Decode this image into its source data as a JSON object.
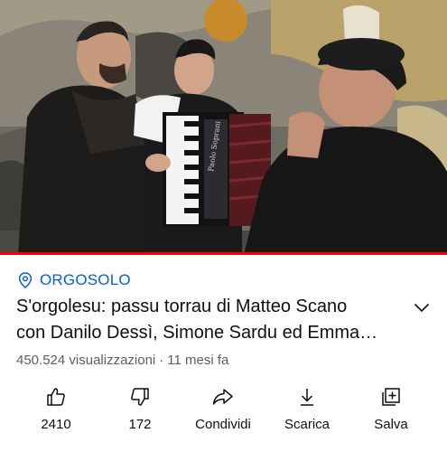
{
  "video": {
    "thumbnail": "four men in a street scene in front of a graffiti mural, one playing an accordion",
    "accordion_brand": "Paolo Soprani",
    "progress_fraction": 1.0
  },
  "location": {
    "icon": "location-pin-icon",
    "label": "ORGOSOLO",
    "color": "#065fd4"
  },
  "title": {
    "line1": "S'orgolesu: passu torrau di Matteo Scano",
    "line2": "con Danilo Dessì, Simone Sardu ed Emma…"
  },
  "meta": {
    "views": "450.524 visualizzazioni",
    "separator": "·",
    "age": "11 mesi fa"
  },
  "actions": [
    {
      "icon": "thumbs-up-icon",
      "label": "2410"
    },
    {
      "icon": "thumbs-down-icon",
      "label": "172"
    },
    {
      "icon": "share-icon",
      "label": "Condividi"
    },
    {
      "icon": "download-icon",
      "label": "Scarica"
    },
    {
      "icon": "save-to-playlist-icon",
      "label": "Salva"
    }
  ]
}
